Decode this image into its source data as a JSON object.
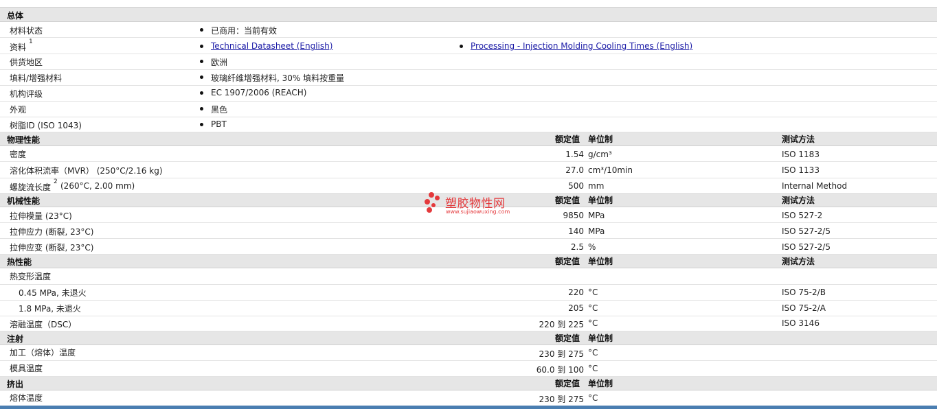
{
  "sections": {
    "general": {
      "title": "总体"
    },
    "physical": {
      "title": "物理性能",
      "col_value": "额定值",
      "col_unit": "单位制",
      "col_method": "测试方法"
    },
    "mechanical": {
      "title": "机械性能",
      "col_value": "额定值",
      "col_unit": "单位制",
      "col_method": "测试方法"
    },
    "thermal": {
      "title": "热性能",
      "col_value": "额定值",
      "col_unit": "单位制",
      "col_method": "测试方法"
    },
    "injection": {
      "title": "注射",
      "col_value": "额定值",
      "col_unit": "单位制"
    },
    "extrusion": {
      "title": "挤出",
      "col_value": "额定值",
      "col_unit": "单位制"
    }
  },
  "general": {
    "status_label": "材料状态",
    "status_value": "已商用：当前有效",
    "docs_label": "资料",
    "docs_sup": "1",
    "doc1": "Technical Datasheet (English)",
    "doc2": "Processing - Injection Molding Cooling Times (English)",
    "region_label": "供货地区",
    "region_value": "欧洲",
    "filler_label": "填料/增强材料",
    "filler_value": "玻璃纤维增强材料, 30% 填料按重量",
    "agency_label": "机构评级",
    "agency_value": "EC 1907/2006 (REACH)",
    "appearance_label": "外观",
    "appearance_value": "黑色",
    "resin_label": "树脂ID (ISO 1043)",
    "resin_value": "PBT"
  },
  "physical": {
    "density": {
      "label": "密度",
      "value": "1.54",
      "unit": "g/cm³",
      "method": "ISO 1183"
    },
    "mvr": {
      "label": "溶化体积流率（MVR） (250°C/2.16 kg)",
      "value": "27.0",
      "unit": "cm³/10min",
      "method": "ISO 1133"
    },
    "spiral": {
      "label": "螺旋流长度",
      "sup": "2",
      "cond": "(260°C, 2.00 mm)",
      "value": "500",
      "unit": "mm",
      "method": "Internal Method"
    }
  },
  "mechanical": {
    "modulus": {
      "label": "拉伸模量 (23°C)",
      "value": "9850",
      "unit": "MPa",
      "method": "ISO 527-2"
    },
    "stress": {
      "label": "拉伸应力 (断裂, 23°C)",
      "value": "140",
      "unit": "MPa",
      "method": "ISO 527-2/5"
    },
    "strain": {
      "label": "拉伸应变 (断裂, 23°C)",
      "value": "2.5",
      "unit": "%",
      "method": "ISO 527-2/5"
    }
  },
  "thermal": {
    "hdt_label": "热变形温度",
    "hdt1": {
      "label": "0.45 MPa, 未退火",
      "value": "220",
      "unit": "°C",
      "method": "ISO 75-2/B"
    },
    "hdt2": {
      "label": "1.8 MPa, 未退火",
      "value": "205",
      "unit": "°C",
      "method": "ISO 75-2/A"
    },
    "melt": {
      "label": "溶融温度（DSC）",
      "value": "220 到 225",
      "unit": "°C",
      "method": "ISO 3146"
    }
  },
  "injection": {
    "melt": {
      "label": "加工（熔体）温度",
      "value": "230 到 275",
      "unit": "°C"
    },
    "mold": {
      "label": "模具温度",
      "value": "60.0 到 100",
      "unit": "°C"
    }
  },
  "extrusion": {
    "melt": {
      "label": "熔体温度",
      "value": "230 到 275",
      "unit": "°C"
    }
  },
  "watermark": {
    "text": "塑胶物性网",
    "url": "www.sujiaowuxing.com"
  },
  "colors": {
    "header_bg": "#e6e6e6",
    "link": "#1a1aa6",
    "watermark": "#e4393c",
    "footer": "#4a7eb1"
  }
}
